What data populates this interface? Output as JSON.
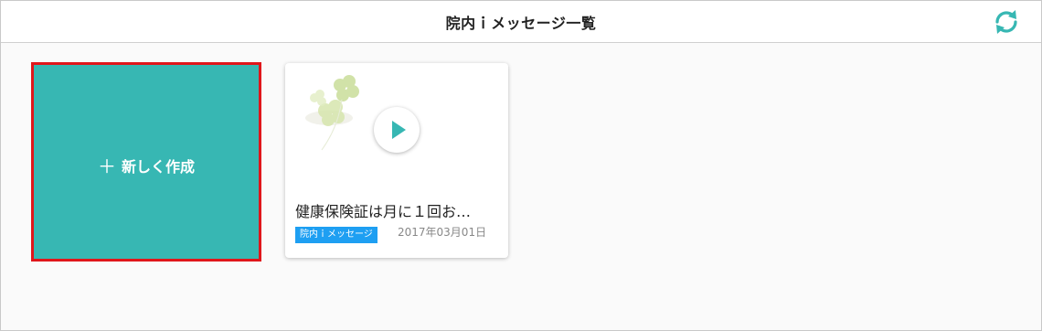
{
  "header": {
    "title": "院内ｉメッセージ一覧",
    "refresh_icon": "refresh-icon",
    "accent_color": "#37b7b3"
  },
  "create_card": {
    "plus": "＋",
    "label": "新しく作成",
    "bg_color": "#37b7b3",
    "border_color": "#e0161b"
  },
  "messages": [
    {
      "title": "健康保険証は月に１回お…",
      "badge": "院内ｉメッセージ",
      "badge_color": "#1e9ff2",
      "date": "2017年03月01日",
      "thumbnail_icon": "clover-leaves-image",
      "play_icon": "play-icon"
    }
  ]
}
